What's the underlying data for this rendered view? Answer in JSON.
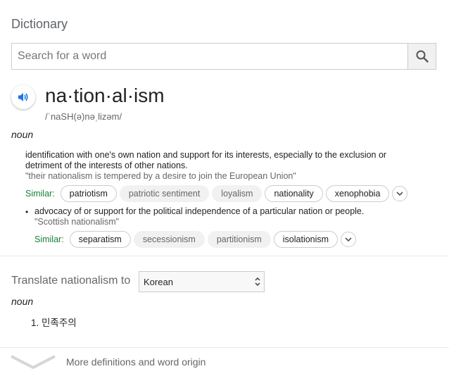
{
  "title": "Dictionary",
  "search": {
    "placeholder": "Search for a word"
  },
  "entry": {
    "headword": "na·tion·al·ism",
    "phonetic": "/ˈnaSH(ə)nəˌlizəm/",
    "pos": "noun",
    "definitions": [
      {
        "text": "identification with one's own nation and support for its interests, especially to the exclusion or detriment of the interests of other nations.",
        "example": "\"their nationalism is tempered by a desire to join the European Union\"",
        "similar_label": "Similar:",
        "similar": [
          "patriotism",
          "patriotic sentiment",
          "loyalism",
          "nationality",
          "xenophobia"
        ]
      },
      {
        "text": "advocacy of or support for the political independence of a particular nation or people.",
        "example": "\"Scottish nationalism\"",
        "similar_label": "Similar:",
        "similar": [
          "separatism",
          "secessionism",
          "partitionism",
          "isolationism"
        ]
      }
    ]
  },
  "translate": {
    "label": "Translate nationalism to",
    "language": "Korean",
    "pos": "noun",
    "items": [
      "1. 민족주의"
    ]
  },
  "footer": {
    "more_label": "More definitions and word origin"
  },
  "colors": {
    "accent_blue": "#1a73e8",
    "similar_green": "#1a7f37"
  }
}
